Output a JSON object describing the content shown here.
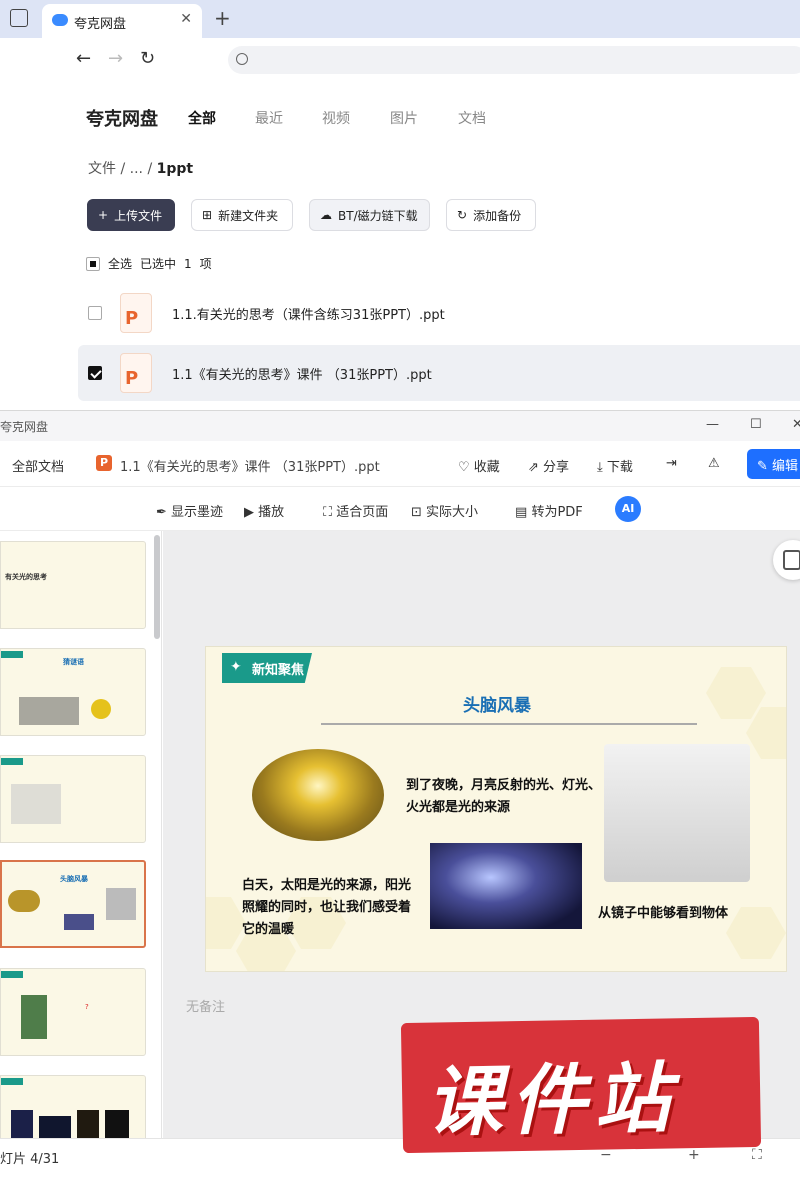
{
  "browser": {
    "tab_title": "夸克网盘",
    "new_tab": "+",
    "close": "✕"
  },
  "app": {
    "logo": "夸克网盘",
    "categories": [
      "全部",
      "最近",
      "视频",
      "图片",
      "文档"
    ],
    "breadcrumb": {
      "root": "文件",
      "sep": "/",
      "ellipsis": "...",
      "current": "1ppt"
    },
    "buttons": {
      "upload": "上传文件",
      "new_folder": "新建文件夹",
      "bt": "BT/磁力链下载",
      "backup": "添加备份"
    },
    "selection": {
      "all": "全选",
      "selected": "已选中",
      "count": "1",
      "unit": "项"
    },
    "files": [
      {
        "name": "1.1.有关光的思考（课件含练习31张PPT）.ppt",
        "checked": false,
        "icon": "P"
      },
      {
        "name": "1.1《有关光的思考》课件 （31张PPT）.ppt",
        "checked": true,
        "icon": "P"
      }
    ]
  },
  "viewer": {
    "window_title": "夸克网盘",
    "all_docs": "全部文档",
    "doc_title": "1.1《有关光的思考》课件 （31张PPT）.ppt",
    "actions": {
      "favorite": "收藏",
      "share": "分享",
      "download": "下载",
      "edit": "编辑"
    },
    "tools": {
      "ink": "显示墨迹",
      "play": "播放",
      "fit": "适合页面",
      "actual": "实际大小",
      "to_pdf": "转为PDF",
      "ai": "AI"
    },
    "thumbnails": [
      {
        "title": "有关光的思考"
      },
      {
        "title": "猜谜语"
      },
      {
        "title": ""
      },
      {
        "title": "头脑风暴"
      },
      {
        "title": ""
      },
      {
        "title": ""
      }
    ],
    "slide": {
      "badge": "新知聚焦",
      "title": "头脑风暴",
      "text1": "到了夜晚，月亮反射的光、灯光、火光都是光的来源",
      "text2": "白天，太阳是光的来源，阳光照耀的同时，也让我们感受着它的温暖",
      "text3": "从镜子中能够看到物体"
    },
    "notes": "无备注",
    "status": "灯片 4/31",
    "watermark": "课件站"
  }
}
